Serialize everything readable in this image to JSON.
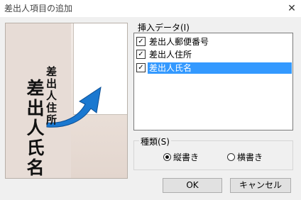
{
  "window": {
    "title": "差出人項目の追加",
    "close_glyph": "✕"
  },
  "preview": {
    "address_text": "差出人住所",
    "name_text": "差出人氏名",
    "arrow_color": "#1a78d0"
  },
  "data_list": {
    "label": "挿入データ(I)",
    "items": [
      {
        "label": "差出人郵便番号",
        "checked": true,
        "selected": false
      },
      {
        "label": "差出人住所",
        "checked": true,
        "selected": false
      },
      {
        "label": "差出人氏名",
        "checked": true,
        "selected": true
      }
    ],
    "check_glyph": "✓",
    "selection_color": "#3399ff"
  },
  "type_group": {
    "label": "種類(S)",
    "options": [
      {
        "label": "縦書き",
        "selected": true
      },
      {
        "label": "横書き",
        "selected": false
      }
    ]
  },
  "buttons": {
    "ok": "OK",
    "cancel": "キャンセル"
  }
}
